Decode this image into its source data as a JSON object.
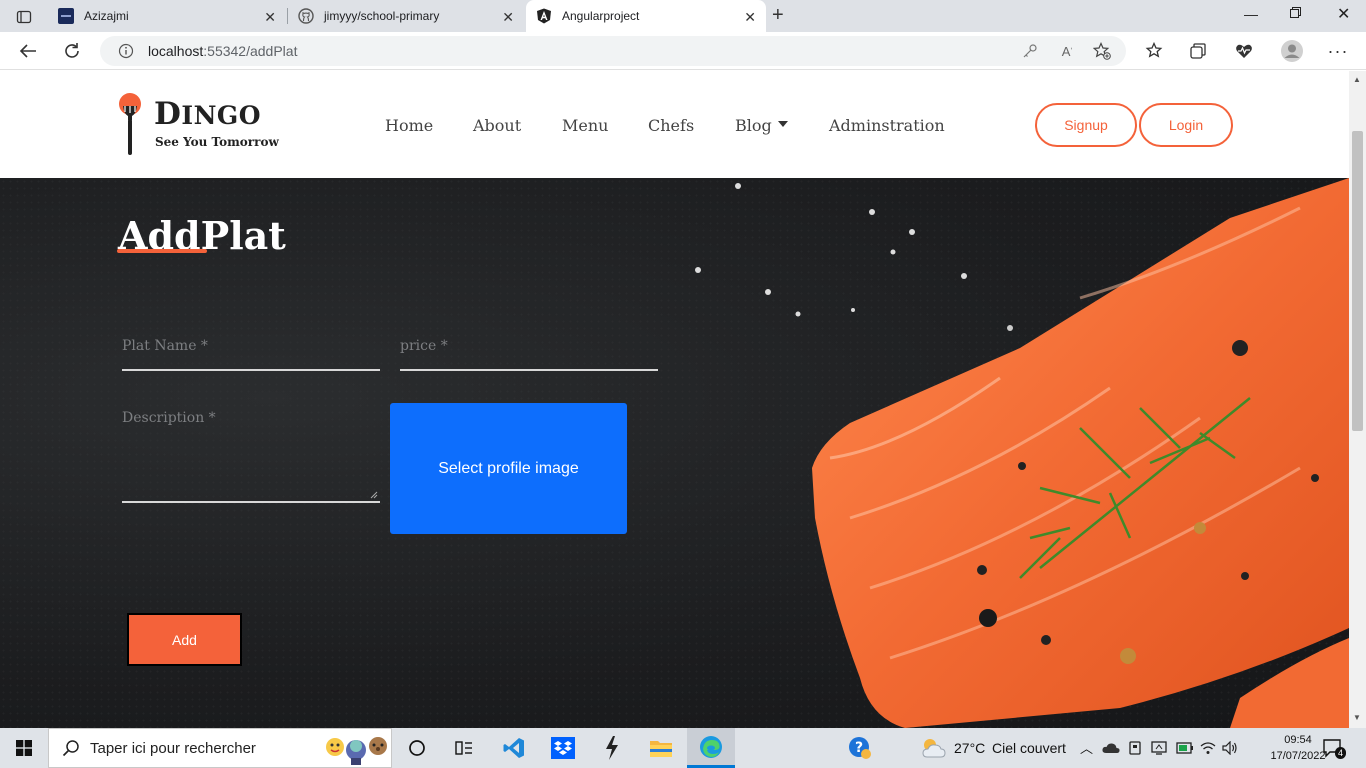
{
  "browser": {
    "tabs": [
      {
        "title": "Azizajmi",
        "icon": "app-icon"
      },
      {
        "title": "jimyyy/school-primary",
        "icon": "github-icon"
      },
      {
        "title": "Angularproject",
        "icon": "angular-icon",
        "active": true
      }
    ],
    "address": {
      "host": "localhost",
      "path": ":55342/addPlat"
    }
  },
  "site": {
    "logo": {
      "name": "Dingo",
      "tagline": "See You Tomorrow"
    },
    "nav": [
      {
        "label": "Home"
      },
      {
        "label": "About"
      },
      {
        "label": "Menu"
      },
      {
        "label": "Chefs"
      },
      {
        "label": "Blog",
        "dropdown": true
      },
      {
        "label": "Adminstration"
      }
    ],
    "auth": {
      "signup": "Signup",
      "login": "Login"
    },
    "accent": "#f4623a"
  },
  "form": {
    "title": "AddPlat",
    "plat_name_placeholder": "Plat Name *",
    "price_placeholder": "price *",
    "description_placeholder": "Description *",
    "upload_label": "Select profile image",
    "submit_label": "Add",
    "upload_color": "#0d6efd"
  },
  "taskbar": {
    "search_placeholder": "Taper ici pour rechercher",
    "weather": {
      "temp": "27°C",
      "condition": "Ciel couvert"
    },
    "time": "09:54",
    "date": "17/07/2022",
    "notifications": "4"
  }
}
